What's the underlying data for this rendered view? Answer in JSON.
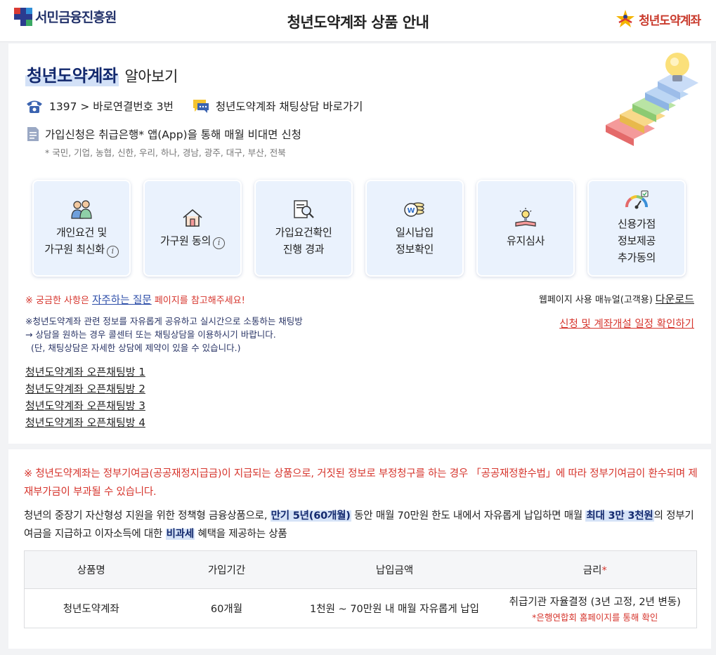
{
  "header": {
    "left_brand": "서민금융진흥원",
    "title": "청년도약계좌 상품 안내",
    "right_brand": "청년도약계좌"
  },
  "intro": {
    "title_main": "청년도약계좌",
    "title_sub": "알아보기",
    "phone_label": "1397 > 바로연결번호 3번",
    "chat_label": "청년도약계좌 채팅상담 바로가기",
    "apply_label": "가입신청은 취급은행* 앱(App)을 통해 매월 비대면 신청",
    "banks_note": "* 국민, 기업, 농협, 신한, 우리, 하나, 경남, 광주, 대구, 부산, 전북"
  },
  "cards": [
    {
      "line1": "개인요건 및",
      "line2": "가구원 최신화",
      "line3": "",
      "info": true,
      "icon": "people-icon"
    },
    {
      "line1": "가구원 동의",
      "line2": "",
      "line3": "",
      "info": true,
      "icon": "house-icon"
    },
    {
      "line1": "가입요건확인",
      "line2": "진행 경과",
      "line3": "",
      "info": false,
      "icon": "document-search-icon"
    },
    {
      "line1": "일시납입",
      "line2": "정보확인",
      "line3": "",
      "info": false,
      "icon": "coins-icon"
    },
    {
      "line1": "유지심사",
      "line2": "",
      "line3": "",
      "info": false,
      "icon": "lightbulb-book-icon"
    },
    {
      "line1": "신용가점",
      "line2": "정보제공",
      "line3": "추가동의",
      "info": false,
      "icon": "gauge-icon"
    }
  ],
  "notices": {
    "faq_prefix": "※ 궁금한 사항은 ",
    "faq_link": "자주하는 질문",
    "faq_suffix": " 페이지를 참고해주세요!",
    "manual_label": "웹페이지 사용 매뉴얼(고객용)",
    "manual_link": "다운로드",
    "schedule_link": "신청 및 계좌개설 일정 확인하기",
    "chat_info_1": "※청년도약계좌 관련 정보를 자유롭게 공유하고 실시간으로 소통하는 채팅방",
    "chat_info_2": "→ 상담을 원하는 경우 콜센터 또는 채팅상담을 이용하시기 바랍니다.",
    "chat_info_3": "(단, 채팅상담은 자세한 상담에 제약이 있을 수 있습니다.)"
  },
  "chat_rooms": [
    "청년도약계좌 오픈채팅방 1",
    "청년도약계좌 오픈채팅방 2",
    "청년도약계좌 오픈채팅방 3",
    "청년도약계좌 오픈채팅방 4"
  ],
  "product": {
    "warning": "※ 청년도약계좌는 정부기여금(공공재정지급금)이 지급되는 상품으로, 거짓된 정보로 부정청구를 하는 경우 「공공재정환수법」에 따라 정부기여금이 환수되며 제재부가금이 부과될 수 있습니다.",
    "desc_1": "청년의 중장기 자산형성 지원을 위한 정책형 금융상품으로, ",
    "desc_hl1": "만기 5년(60개월)",
    "desc_2": " 동안 매월 70만원 한도 내에서 자유롭게 납입하면 매월 ",
    "desc_hl2": "최대 3만 3천원",
    "desc_3": "의 정부기여금을 지급하고 이자소득에 대한 ",
    "desc_hl3": "비과세",
    "desc_4": " 혜택을 제공하는 상품",
    "table": {
      "headers": [
        "상품명",
        "가입기간",
        "납입금액",
        "금리"
      ],
      "rate_star": "*",
      "row": {
        "name": "청년도약계좌",
        "period": "60개월",
        "amount": "1천원 ~ 70만원 내 매월 자유롭게 납입",
        "rate": "취급기관 자율결정 (3년 고정, 2년 변동)",
        "rate_note": "*은행연합회 홈페이지를 통해 확인"
      }
    }
  }
}
